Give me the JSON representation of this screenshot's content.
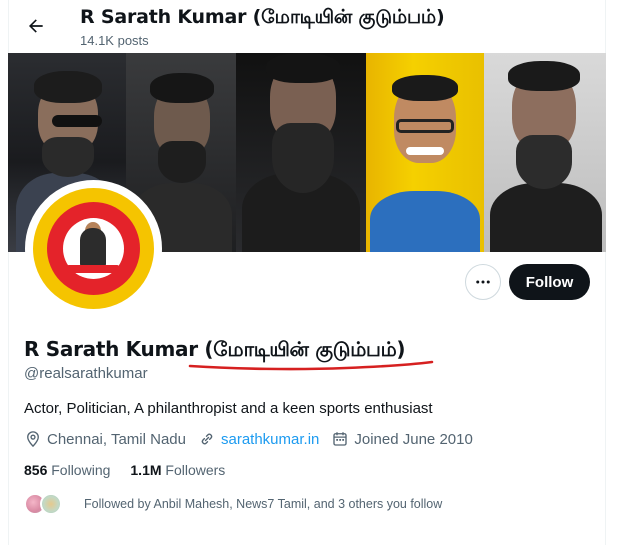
{
  "header": {
    "name": "R Sarath Kumar (மோடியின் குடும்பம்)",
    "post_count": "14.1K posts"
  },
  "actions": {
    "more_icon": "ellipsis-icon",
    "follow_label": "Follow"
  },
  "profile": {
    "display_name": "R Sarath Kumar (மோடியின் குடும்பம்)",
    "handle": "@realsarathkumar",
    "bio": "Actor, Politician, A philanthropist and a keen sports enthusiast",
    "location": "Chennai, Tamil Nadu",
    "website": "sarathkumar.in",
    "joined": "Joined June 2010"
  },
  "stats": {
    "following_count": "856",
    "following_label": "Following",
    "followers_count": "1.1M",
    "followers_label": "Followers"
  },
  "followed_by": {
    "text": "Followed by Anbil Mahesh, News7 Tamil, and 3 others you follow"
  },
  "colors": {
    "follow_button_bg": "#0f1419",
    "link": "#1d9bf0",
    "secondary_text": "#536471",
    "annotation_underline": "#d62020"
  }
}
